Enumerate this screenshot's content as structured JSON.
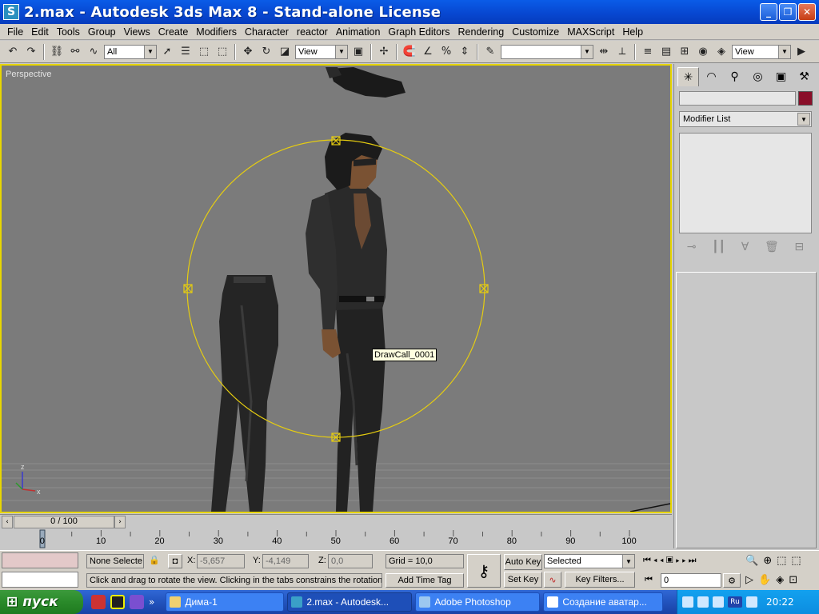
{
  "window": {
    "title": "2.max - Autodesk 3ds Max 8  - Stand-alone License",
    "app_icon": "S"
  },
  "menu": [
    "File",
    "Edit",
    "Tools",
    "Group",
    "Views",
    "Create",
    "Modifiers",
    "Character",
    "reactor",
    "Animation",
    "Graph Editors",
    "Rendering",
    "Customize",
    "MAXScript",
    "Help"
  ],
  "toolbar": {
    "selection_filter": "All",
    "ref_coord": "View",
    "named_selection": "",
    "render_type": "View"
  },
  "viewport": {
    "label": "Perspective",
    "tooltip": "DrawCall_0001",
    "axis_labels": {
      "z": "z",
      "x": "x"
    }
  },
  "command_panel": {
    "object_name": "",
    "object_color": "#8a0f2a",
    "modifier_list": "Modifier List"
  },
  "timeline": {
    "slider": "0 / 100",
    "ticks": [
      "0",
      "10",
      "20",
      "30",
      "40",
      "50",
      "60",
      "70",
      "80",
      "90",
      "100"
    ]
  },
  "status": {
    "selection_info": "None Selecte",
    "x_label": "X:",
    "x_value": "-5,657",
    "y_label": "Y:",
    "y_value": "-4,149",
    "z_label": "Z:",
    "z_value": "0,0",
    "grid": "Grid = 10,0",
    "prompt": "Click and drag to rotate the view.  Clicking in the tabs constrains the rotation",
    "add_time_tag": "Add Time Tag",
    "auto_key": "Auto Key",
    "set_key": "Set Key",
    "key_mode": "Selected",
    "key_filters": "Key Filters...",
    "frame": "0"
  },
  "taskbar": {
    "start": "пуск",
    "tasks": [
      {
        "label": "Дима-1",
        "active": false
      },
      {
        "label": "2.max - Autodesk...",
        "active": true
      },
      {
        "label": "Adobe Photoshop",
        "active": false
      },
      {
        "label": "Создание аватар...",
        "active": false
      }
    ],
    "lang": "RU",
    "tray_lang": "Ru",
    "clock": "20:22"
  }
}
